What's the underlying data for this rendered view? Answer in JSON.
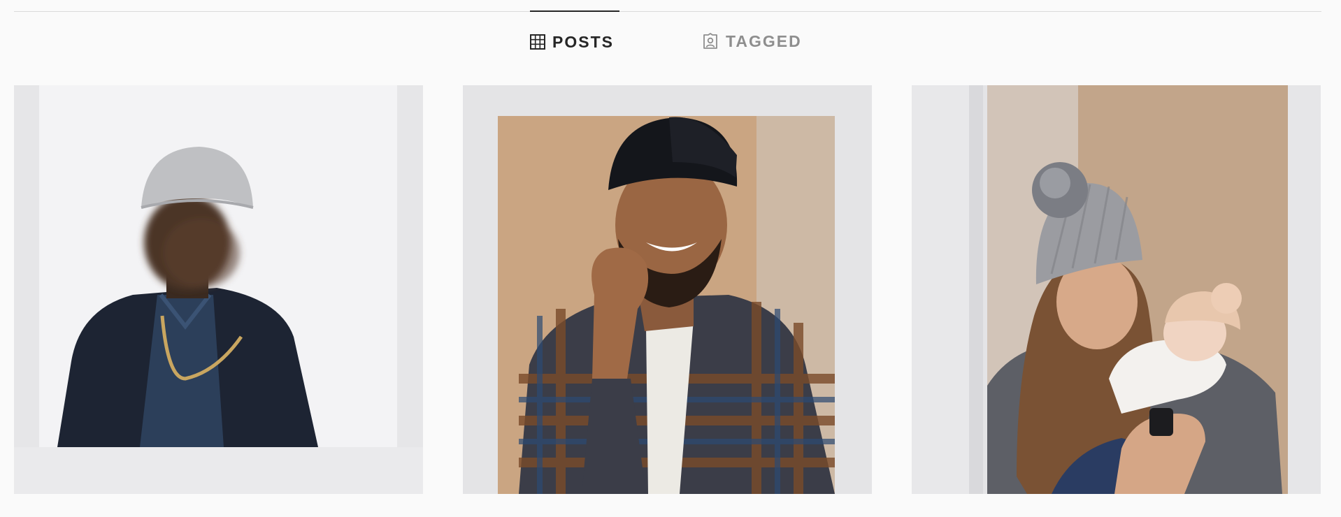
{
  "tabs": [
    {
      "label": "POSTS",
      "icon": "grid-icon",
      "active": true
    },
    {
      "label": "TAGGED",
      "icon": "tagged-user-icon",
      "active": false
    }
  ],
  "colors": {
    "background": "#fafafa",
    "active_tab_text": "#262626",
    "inactive_tab_text": "#8e8e8e",
    "divider": "#dbdbdb"
  },
  "posts": [
    {
      "subject": "polaroid-man-grey-beanie-blurred"
    },
    {
      "subject": "polaroid-man-black-cap-smiling"
    },
    {
      "subject": "polaroid-woman-pom-beanie-holding-baby"
    }
  ]
}
